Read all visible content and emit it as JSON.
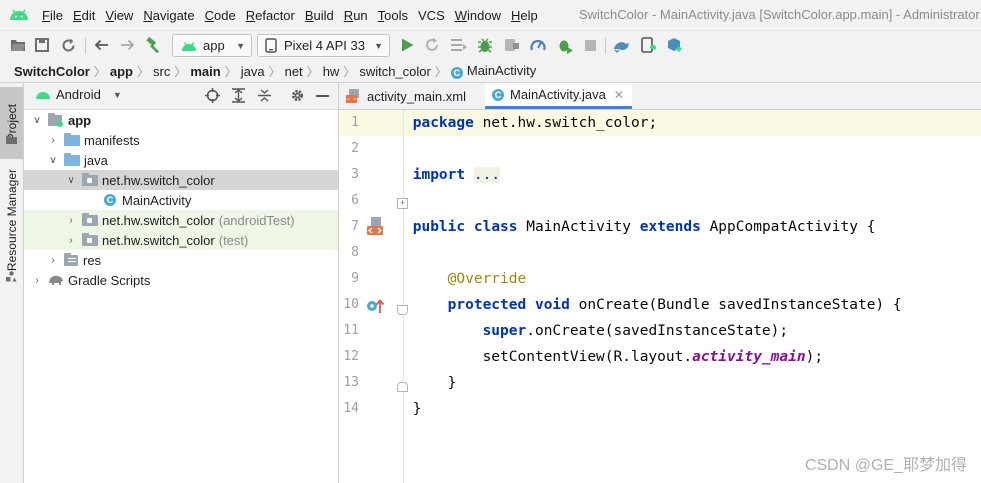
{
  "app": {
    "title": "SwitchColor - MainActivity.java [SwitchColor.app.main] - Administrator"
  },
  "menu": [
    {
      "label": "File",
      "mnemonic": "F",
      "rest": "ile"
    },
    {
      "label": "Edit",
      "mnemonic": "E",
      "rest": "dit"
    },
    {
      "label": "View",
      "mnemonic": "V",
      "rest": "iew"
    },
    {
      "label": "Navigate",
      "mnemonic": "N",
      "rest": "avigate"
    },
    {
      "label": "Code",
      "mnemonic": "C",
      "rest": "ode"
    },
    {
      "label": "Refactor",
      "mnemonic": "R",
      "rest": "efactor"
    },
    {
      "label": "Build",
      "mnemonic": "B",
      "rest": "uild"
    },
    {
      "label": "Run",
      "mnemonic": "R",
      "rest": "un"
    },
    {
      "label": "Tools",
      "mnemonic": "T",
      "rest": "ools"
    },
    {
      "label": "VCS",
      "mnemonic": "",
      "rest": "VCS"
    },
    {
      "label": "Window",
      "mnemonic": "W",
      "rest": "indow"
    },
    {
      "label": "Help",
      "mnemonic": "H",
      "rest": "elp"
    }
  ],
  "toolbar": {
    "run_config": "app",
    "device": "Pixel 4 API 33",
    "icons": [
      "open-folder-icon",
      "save-icon",
      "sync-icon",
      "back-icon",
      "forward-icon",
      "build-hammer-icon",
      "run-icon",
      "apply-changes-icon",
      "apply-code-changes-icon",
      "debug-icon",
      "attach-debugger-icon",
      "profile-icon",
      "coverage-icon",
      "stop-icon",
      "gradle-sync-icon",
      "device-manager-icon",
      "sdk-manager-icon"
    ]
  },
  "breadcrumb": [
    "SwitchColor",
    "app",
    "src",
    "main",
    "java",
    "net",
    "hw",
    "switch_color",
    "MainActivity"
  ],
  "left_strip": {
    "project_tab": "Project",
    "resource_tab": "Resource Manager"
  },
  "project_panel": {
    "view_mode": "Android",
    "tree": [
      {
        "label": "app",
        "suffix": "",
        "level": 0,
        "arrow": "down"
      },
      {
        "label": "manifests",
        "suffix": "",
        "level": 1,
        "arrow": "right"
      },
      {
        "label": "java",
        "suffix": "",
        "level": 1,
        "arrow": "down"
      },
      {
        "label": "net.hw.switch_color",
        "suffix": "",
        "level": 2,
        "arrow": "down"
      },
      {
        "label": "MainActivity",
        "suffix": "",
        "level": 3,
        "arrow": "none"
      },
      {
        "label": "net.hw.switch_color",
        "suffix": "(androidTest)",
        "level": 2,
        "arrow": "right"
      },
      {
        "label": "net.hw.switch_color",
        "suffix": "(test)",
        "level": 2,
        "arrow": "right"
      },
      {
        "label": "res",
        "suffix": "",
        "level": 1,
        "arrow": "right"
      },
      {
        "label": "Gradle Scripts",
        "suffix": "",
        "level": 0,
        "arrow": "right"
      }
    ]
  },
  "editor": {
    "tabs": [
      {
        "label": "activity_main.xml",
        "active": false
      },
      {
        "label": "MainActivity.java",
        "active": true
      }
    ],
    "line_numbers": [
      "1",
      "2",
      "3",
      "6",
      "7",
      "8",
      "9",
      "10",
      "11",
      "12",
      "13",
      "14"
    ],
    "code": {
      "l1_kw": "package",
      "l1_rest": " net.hw.switch_color;",
      "l3_kw": "import",
      "l3_fold": "...",
      "l7_kw1": "public",
      "l7_kw2": "class",
      "l7_name": " MainActivity ",
      "l7_kw3": "extends",
      "l7_rest": " AppCompatActivity {",
      "l9_ann": "    @Override",
      "l10_kw1": "    protected",
      "l10_kw2": "void",
      "l10_rest": " onCreate(Bundle savedInstanceState) {",
      "l11_kw": "        super",
      "l11_rest": ".onCreate(savedInstanceState);",
      "l12_a": "        setContentView(R.layout.",
      "l12_field": "activity_main",
      "l12_b": ");",
      "l13": "    }",
      "l14": "}"
    }
  },
  "watermark": "CSDN @GE_耶梦加得",
  "colors": {
    "accent": "#4083c9",
    "keyword": "#0033b3",
    "annotation": "#9e880d",
    "android_green": "#3ddc84",
    "run_green": "#4c9e4e",
    "class_badge": "#49a9d3"
  }
}
